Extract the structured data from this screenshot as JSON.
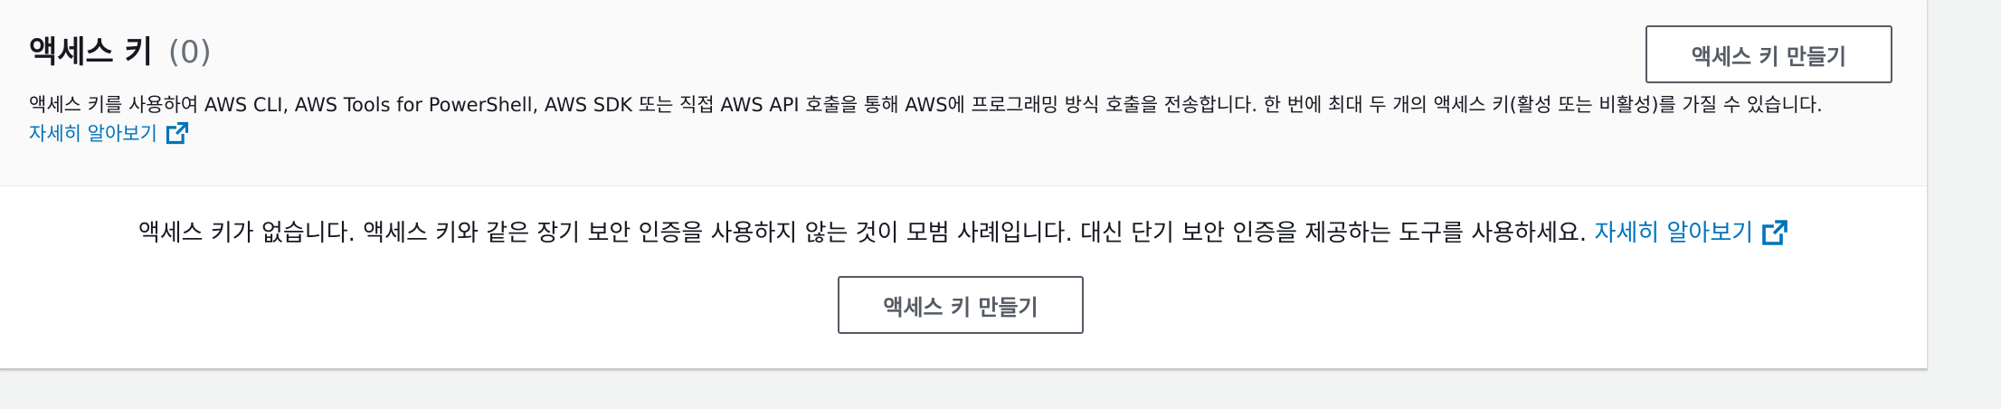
{
  "section": {
    "title": "액세스 키",
    "count": "(0)",
    "description": "액세스 키를 사용하여 AWS CLI, AWS Tools for PowerShell, AWS SDK 또는 직접 AWS API 호출을 통해 AWS에 프로그래밍 방식 호출을 전송합니다. 한 번에 최대 두 개의 액세스 키(활성 또는 비활성)를 가질 수 있습니다.",
    "learn_more": "자세히 알아보기",
    "create_button": "액세스 키 만들기"
  },
  "empty_state": {
    "message": "액세스 키가 없습니다. 액세스 키와 같은 장기 보안 인증을 사용하지 않는 것이 모범 사례입니다. 대신 단기 보안 인증을 제공하는 도구를 사용하세요.",
    "learn_more": "자세히 알아보기",
    "create_button": "액세스 키 만들기"
  },
  "icons": {
    "external_link": "external-link-icon"
  },
  "colors": {
    "link": "#0073bb",
    "button_border": "#545b64",
    "header_bg": "#fafafa",
    "page_bg": "#f2f3f3"
  }
}
